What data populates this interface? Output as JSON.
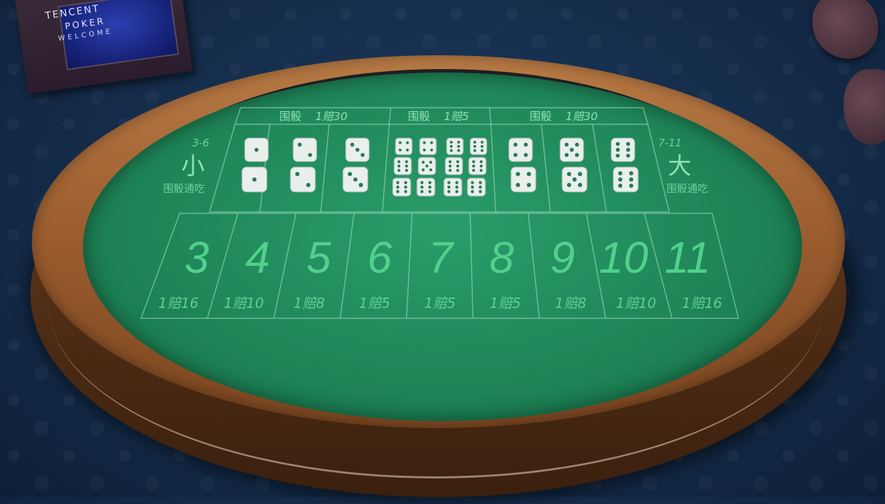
{
  "poster": {
    "line1": "TENCENT",
    "line2": "POKER",
    "line3": "WELCOME"
  },
  "headers": [
    {
      "label": "围骰",
      "odds": "1赔30"
    },
    {
      "label": "围骰",
      "odds": "1赔5"
    },
    {
      "label": "围骰",
      "odds": "1赔30"
    }
  ],
  "small": {
    "range": "3-6",
    "label": "小",
    "note": "围骰通吃"
  },
  "big": {
    "range": "7-11",
    "label": "大",
    "note": "围骰通吃"
  },
  "triples_left": [
    [
      1,
      1
    ],
    [
      2,
      2
    ],
    [
      3,
      3
    ]
  ],
  "middle_grid": [
    [
      4,
      4,
      6,
      6
    ],
    [
      6,
      5,
      6,
      6
    ],
    [
      6,
      6,
      6,
      6
    ]
  ],
  "triples_right": [
    [
      4,
      4
    ],
    [
      5,
      5
    ],
    [
      6,
      6
    ]
  ],
  "totals": [
    {
      "number": "3",
      "odds": "1赔16"
    },
    {
      "number": "4",
      "odds": "1赔10"
    },
    {
      "number": "5",
      "odds": "1赔8"
    },
    {
      "number": "6",
      "odds": "1赔5"
    },
    {
      "number": "7",
      "odds": "1赔5"
    },
    {
      "number": "8",
      "odds": "1赔5"
    },
    {
      "number": "9",
      "odds": "1赔8"
    },
    {
      "number": "10",
      "odds": "1赔10"
    },
    {
      "number": "11",
      "odds": "1赔16"
    }
  ],
  "colors": {
    "felt": "#1f8658",
    "wood": "#9a5c2e",
    "text": "#8fe0b6"
  }
}
